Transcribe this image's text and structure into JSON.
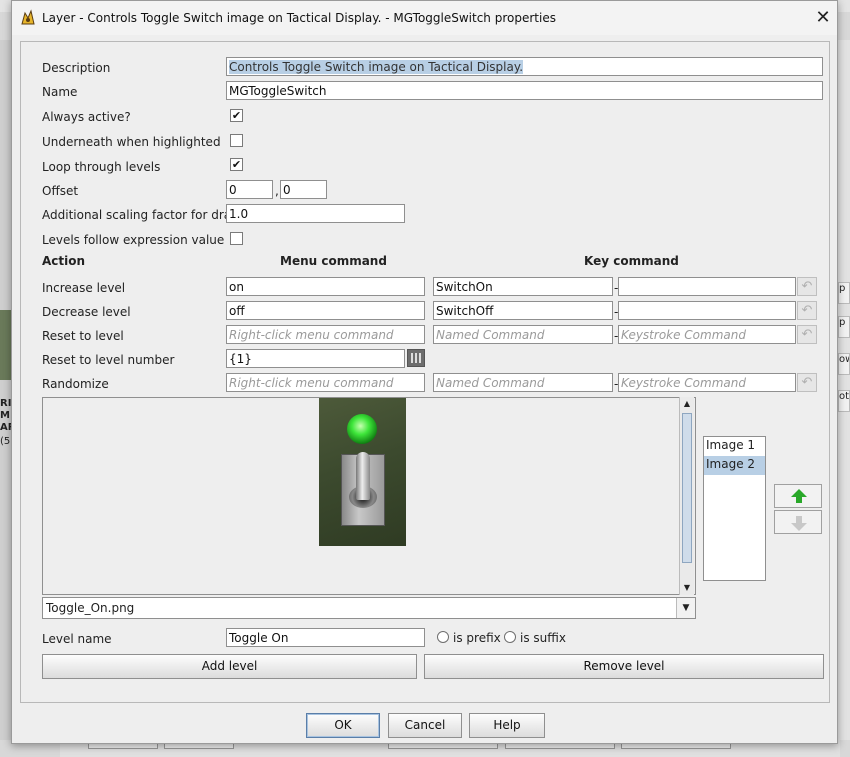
{
  "window": {
    "title": "Layer - Controls Toggle Switch image on Tactical Display. - MGToggleSwitch properties",
    "close_symbol": "✕"
  },
  "background": {
    "left_texts": [
      "RI",
      "M",
      "AR",
      "(5"
    ],
    "right_texts": [
      "p",
      "p",
      "ow",
      "ott"
    ]
  },
  "form": {
    "description": {
      "label": "Description",
      "value": "Controls Toggle Switch image on Tactical Display."
    },
    "name": {
      "label": "Name",
      "value": "MGToggleSwitch"
    },
    "always_active": {
      "label": "Always active?",
      "checked": true
    },
    "underneath": {
      "label": "Underneath when highlighted",
      "checked": false
    },
    "loop": {
      "label": "Loop through levels",
      "checked": true
    },
    "offset": {
      "label": "Offset",
      "x": "0",
      "separator": ",",
      "y": "0"
    },
    "scaling": {
      "label": "Additional scaling factor for draw",
      "value": "1.0"
    },
    "follow_expr": {
      "label": "Levels follow expression value",
      "checked": false
    }
  },
  "actions": {
    "headers": {
      "action": "Action",
      "menu": "Menu command",
      "key": "Key command"
    },
    "rows": [
      {
        "label": "Increase level",
        "menu": "on",
        "named": "SwitchOn",
        "key": ""
      },
      {
        "label": "Decrease level",
        "menu": "off",
        "named": "SwitchOff",
        "key": ""
      },
      {
        "label": "Reset to level",
        "menu": "Right-click menu command",
        "named": "Named Command",
        "key": "Keystroke Command"
      },
      {
        "label": "Reset to level number",
        "menu": "{1}"
      },
      {
        "label": "Randomize",
        "menu": "Right-click menu command",
        "named": "Named Command",
        "key": "Keystroke Command"
      }
    ],
    "dash": "-",
    "check_mark": "✔",
    "undo_symbol": "↶"
  },
  "images": {
    "selected_file": "Toggle_On.png",
    "list": [
      "Image 1",
      "Image 2"
    ],
    "active_index": 1,
    "icons": {
      "move_up": "up-arrow-icon",
      "move_down": "down-arrow-icon"
    },
    "scroll_up": "▲",
    "scroll_down": "▼",
    "combo_arrow": "▼"
  },
  "level": {
    "label": "Level name",
    "value": "Toggle On",
    "prefix": "is prefix",
    "suffix": "is suffix",
    "add": "Add level",
    "remove": "Remove level"
  },
  "buttons": {
    "ok": "OK",
    "cancel": "Cancel",
    "help": "Help"
  },
  "colors": {
    "selection": "#b8cfe5",
    "led": "#3ee63a",
    "up_arrow": "#29a829"
  }
}
